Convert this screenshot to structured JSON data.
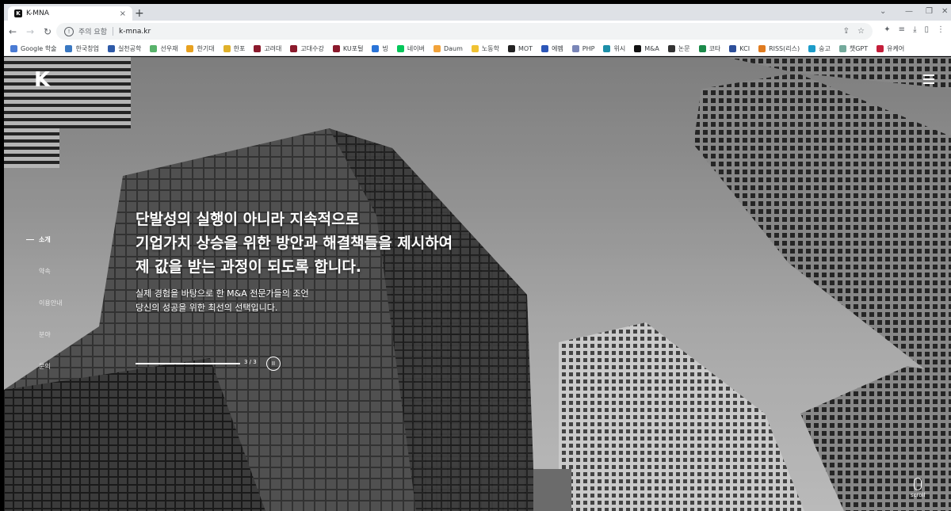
{
  "browser": {
    "tab_title": "K-MNA",
    "favicon": "K",
    "close_glyph": "×",
    "newtab_glyph": "+",
    "security_text": "주의 요함",
    "url": "k-mna.kr",
    "bookmarks": [
      {
        "label": "Google 학술",
        "color": "#4a7bd4"
      },
      {
        "label": "한국창업",
        "color": "#3a78c2"
      },
      {
        "label": "실천공학",
        "color": "#2e5aa8"
      },
      {
        "label": "선우재",
        "color": "#59b36b"
      },
      {
        "label": "한기대",
        "color": "#e8a11f"
      },
      {
        "label": "한포",
        "color": "#e0b12a"
      },
      {
        "label": "고려대",
        "color": "#8b1a2c"
      },
      {
        "label": "고대수강",
        "color": "#8b1a2c"
      },
      {
        "label": "KU포털",
        "color": "#8b1a2c"
      },
      {
        "label": "빙",
        "color": "#2a74d8"
      },
      {
        "label": "네이버",
        "color": "#03c75a"
      },
      {
        "label": "Daum",
        "color": "#f2a33a"
      },
      {
        "label": "노동학",
        "color": "#f0c232"
      },
      {
        "label": "MOT",
        "color": "#222222"
      },
      {
        "label": "에펨",
        "color": "#2c56b8"
      },
      {
        "label": "PHP",
        "color": "#7a86b8"
      },
      {
        "label": "위시",
        "color": "#1d8fa8"
      },
      {
        "label": "M&A",
        "color": "#111111"
      },
      {
        "label": "논문",
        "color": "#333333"
      },
      {
        "label": "코타",
        "color": "#1b8a4a"
      },
      {
        "label": "KCI",
        "color": "#2d4f9a"
      },
      {
        "label": "RISS(리스)",
        "color": "#e07b1f"
      },
      {
        "label": "숭고",
        "color": "#1c9cc9"
      },
      {
        "label": "챗GPT",
        "color": "#74aa9c"
      },
      {
        "label": "유케어",
        "color": "#c41e3a"
      }
    ]
  },
  "site": {
    "logo": "K",
    "nav": [
      {
        "label": "소개",
        "active": true
      },
      {
        "label": "약속",
        "active": false
      },
      {
        "label": "이용안내",
        "active": false
      },
      {
        "label": "분야",
        "active": false
      },
      {
        "label": "문의",
        "active": false
      }
    ],
    "headline": [
      "단발성의 실행이 아니라 지속적으로",
      "기업가치 상승을 위한 방안과 해결책들을 제시하여",
      "제 값을 받는 과정이 되도록 합니다."
    ],
    "subtext": [
      "실제 경험을 바탕으로 한 M&A 전문가들의 조언",
      "당신의 성공을 위한 최선의 선택입니다."
    ],
    "slider": {
      "counter": "3 / 3",
      "progress": 1.0,
      "pause_glyph": "II"
    },
    "scroll_label": "scroll"
  }
}
